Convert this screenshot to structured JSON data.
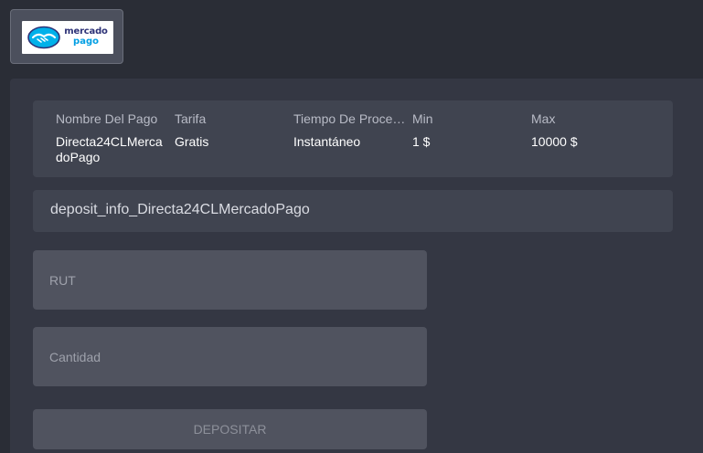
{
  "payment_method": {
    "logo_line1": "mercado",
    "logo_line2": "pago",
    "logo_icon": "handshake-icon"
  },
  "info": {
    "columns": [
      {
        "header": "Nombre Del Pago",
        "value": "Directa24CLMercadoPago"
      },
      {
        "header": "Tarifa",
        "value": "Gratis"
      },
      {
        "header": "Tiempo De Procesamiento",
        "value": "Instantáneo"
      },
      {
        "header": "Min",
        "value": "1 $"
      },
      {
        "header": "Max",
        "value": "10000 $"
      }
    ]
  },
  "deposit_info_text": "deposit_info_Directa24CLMercadoPago",
  "form": {
    "rut_placeholder": "RUT",
    "amount_placeholder": "Cantidad",
    "submit_label": "DEPOSITAR"
  },
  "colors": {
    "background": "#2a2d36",
    "panel": "#343743",
    "card": "#404450",
    "input": "#50535f"
  }
}
